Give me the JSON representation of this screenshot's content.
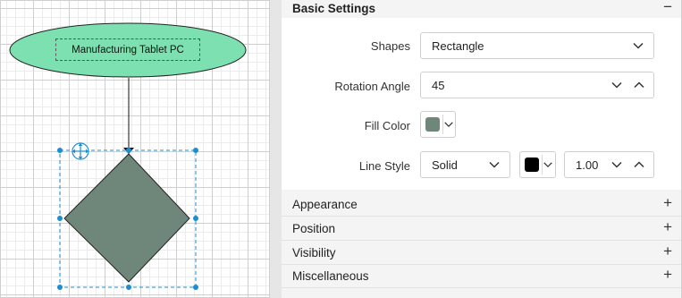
{
  "canvas": {
    "start_node_label": "Manufacturing Tablet PC",
    "colors": {
      "ellipse_fill": "#7de0b0",
      "diamond_fill": "#6f877a",
      "selection": "#1b8ed3"
    }
  },
  "panel": {
    "basic_settings": {
      "title": "Basic Settings",
      "collapse_symbol": "−",
      "shapes": {
        "label": "Shapes",
        "value": "Rectangle"
      },
      "rotation_angle": {
        "label": "Rotation Angle",
        "value": "45"
      },
      "fill_color": {
        "label": "Fill Color",
        "color": "#6f877a"
      },
      "line_style": {
        "label": "Line Style",
        "style_value": "Solid",
        "color": "#000000",
        "width_value": "1.00"
      }
    },
    "sections": [
      {
        "title": "Appearance",
        "toggle": "+"
      },
      {
        "title": "Position",
        "toggle": "+"
      },
      {
        "title": "Visibility",
        "toggle": "+"
      },
      {
        "title": "Miscellaneous",
        "toggle": "+"
      }
    ]
  }
}
